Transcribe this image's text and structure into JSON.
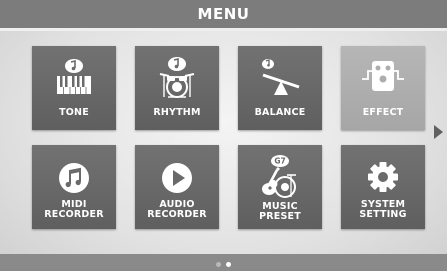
{
  "header": {
    "title": "MENU"
  },
  "menu": {
    "items": [
      {
        "label": "TONE",
        "icon": "keyboard-icon"
      },
      {
        "label": "RHYTHM",
        "icon": "drums-icon"
      },
      {
        "label": "BALANCE",
        "icon": "seesaw-icon"
      },
      {
        "label": "EFFECT",
        "icon": "effect-pedal-icon"
      },
      {
        "label_line1": "MIDI",
        "label_line2": "RECORDER",
        "icon": "music-note-circle-icon"
      },
      {
        "label_line1": "AUDIO",
        "label_line2": "RECORDER",
        "icon": "play-circle-icon"
      },
      {
        "label_line1": "MUSIC",
        "label_line2": "PRESET",
        "chord": "G7",
        "icon": "guitar-drums-icon"
      },
      {
        "label_line1": "SYSTEM",
        "label_line2": "SETTING",
        "icon": "gear-icon"
      }
    ]
  },
  "pagination": {
    "pages": 2,
    "current": 1
  },
  "colors": {
    "tile": "#6a6a6a",
    "tile_disabled": "#adadad",
    "title_bar": "#7c7c7c"
  }
}
